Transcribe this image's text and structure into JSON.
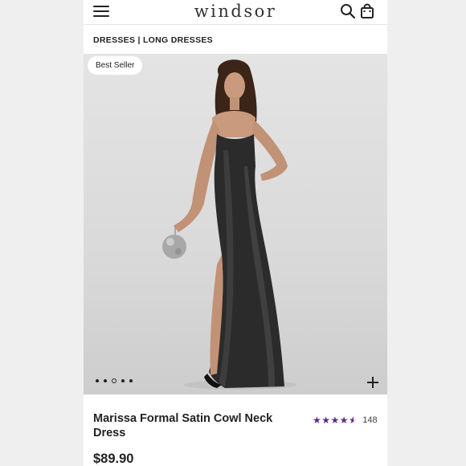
{
  "header": {
    "logo": "WINDSOR",
    "menu_icon": "hamburger-menu-icon",
    "search_icon": "search-icon",
    "bag_icon": "shopping-bag-icon"
  },
  "breadcrumb": "DRESSES | LONG DRESSES",
  "gallery": {
    "badge": "Best Seller",
    "image_count": 5,
    "active_index": 2,
    "zoom_icon": "plus-icon"
  },
  "product": {
    "name": "Marissa Formal Satin Cowl Neck Dress",
    "rating": 4.5,
    "rating_max": 5,
    "review_count": "148",
    "price": "$89.90",
    "star_color": "#5b2d82"
  }
}
